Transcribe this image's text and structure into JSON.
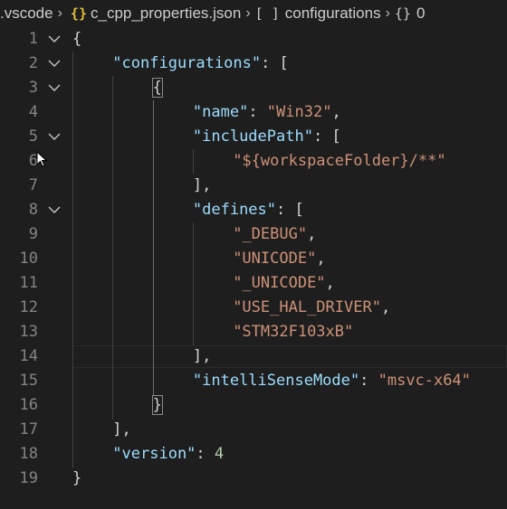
{
  "breadcrumb": {
    "folder": ".vscode",
    "file": "c_cpp_properties.json",
    "section": "configurations",
    "item": "0",
    "json_icon": "{}",
    "array_icon": "[ ]",
    "object_icon": "{}"
  },
  "editor": {
    "language": "json",
    "current_line": 14,
    "lines": [
      {
        "n": "1",
        "t1": "{"
      },
      {
        "n": "2",
        "k": "\"configurations\"",
        "p": ": ["
      },
      {
        "n": "3",
        "t1": "{"
      },
      {
        "n": "4",
        "k": "\"name\"",
        "p": ": ",
        "s": "\"Win32\"",
        "e": ","
      },
      {
        "n": "5",
        "k": "\"includePath\"",
        "p": ": ["
      },
      {
        "n": "6",
        "s": "\"${workspaceFolder}/**\""
      },
      {
        "n": "7",
        "t1": "],"
      },
      {
        "n": "8",
        "k": "\"defines\"",
        "p": ": ["
      },
      {
        "n": "9",
        "s": "\"_DEBUG\"",
        "e": ","
      },
      {
        "n": "10",
        "s": "\"UNICODE\"",
        "e": ","
      },
      {
        "n": "11",
        "s": "\"_UNICODE\"",
        "e": ","
      },
      {
        "n": "12",
        "s": "\"USE_HAL_DRIVER\"",
        "e": ","
      },
      {
        "n": "13",
        "s": "\"STM32F103xB\""
      },
      {
        "n": "14",
        "t1": "],"
      },
      {
        "n": "15",
        "k": "\"intelliSenseMode\"",
        "p": ": ",
        "s": "\"msvc-x64\""
      },
      {
        "n": "16",
        "t1": "}"
      },
      {
        "n": "17",
        "t1": "],"
      },
      {
        "n": "18",
        "k": "\"version\"",
        "p": ": ",
        "num": "4"
      },
      {
        "n": "19",
        "t1": "}"
      }
    ]
  },
  "colors": {
    "background": "#1e1e1e",
    "key": "#9cdcfe",
    "string": "#ce9178",
    "number": "#b5cea8",
    "punctuation": "#d4d4d4",
    "line_number": "#858585",
    "json_icon": "#e2c03a"
  },
  "icons": {
    "fold": "chevron-down-icon",
    "pointer": "mouse-pointer-icon"
  }
}
